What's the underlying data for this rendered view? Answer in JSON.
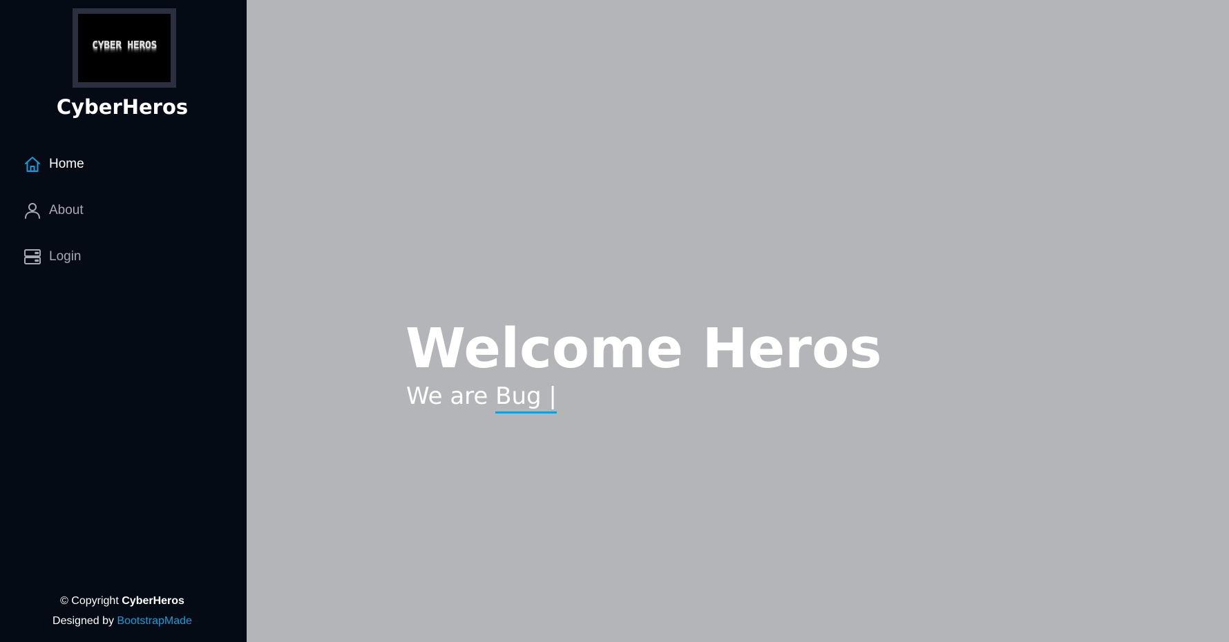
{
  "sidebar": {
    "logo_text": "CYBER HEROS",
    "site_name": "CyberHeros",
    "nav": [
      {
        "label": "Home",
        "icon": "home-icon",
        "active": true
      },
      {
        "label": "About",
        "icon": "person-icon",
        "active": false
      },
      {
        "label": "Login",
        "icon": "server-icon",
        "active": false
      }
    ],
    "footer": {
      "copyright_prefix": "© Copyright",
      "copyright_brand": "CyberHeros",
      "designed_by_prefix": "Designed by",
      "designed_by_link": "BootstrapMade"
    }
  },
  "hero": {
    "title": "Welcome Heros",
    "subtitle_prefix": "We are",
    "typed_text": "Bug |"
  },
  "colors": {
    "accent": "#149ddd",
    "sidebar_bg": "#040b14",
    "hero_bg": "#b4b5b8",
    "nav_inactive": "#a8a9b4"
  }
}
